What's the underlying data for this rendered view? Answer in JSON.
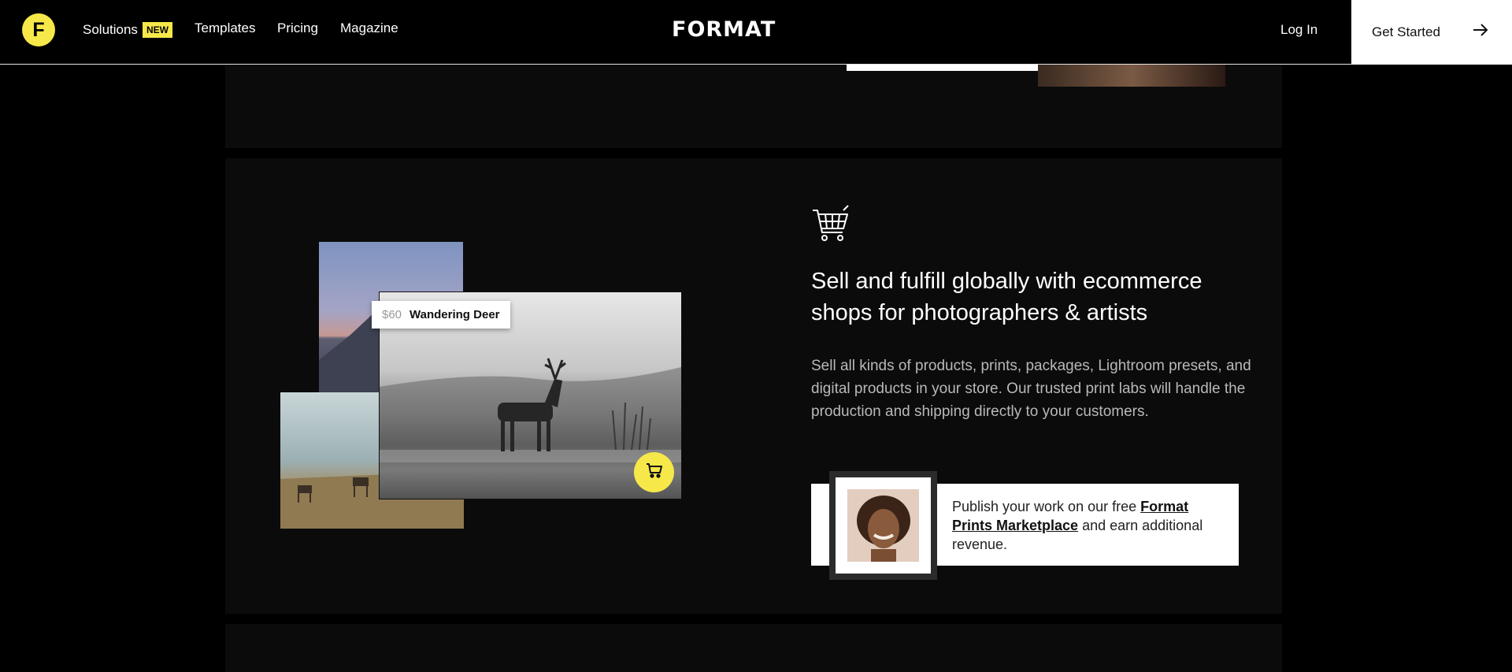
{
  "nav": {
    "logo_letter": "F",
    "solutions_label": "Solutions",
    "new_badge": "NEW",
    "templates_label": "Templates",
    "pricing_label": "Pricing",
    "magazine_label": "Magazine",
    "brand": "FORMAT",
    "login_label": "Log In",
    "get_started_label": "Get Started"
  },
  "feature": {
    "headline": "Sell and fulfill globally with ecommerce shops for photographers & artists",
    "body": "Sell all kinds of products, prints, packages, Lightroom presets, and digital products in your store. Our trusted print labs will handle the production and shipping directly to your customers.",
    "product_price": "$60",
    "product_title": "Wandering Deer",
    "promo_prefix": "Publish your work on our free ",
    "promo_link": "Format Prints Marketplace",
    "promo_suffix": " and earn additional revenue."
  },
  "colors": {
    "accent": "#f7e84a",
    "background": "#000000",
    "panel": "#0b0b0b"
  },
  "icons": [
    "shopping-cart-icon",
    "cart-icon",
    "arrow-right-icon"
  ]
}
